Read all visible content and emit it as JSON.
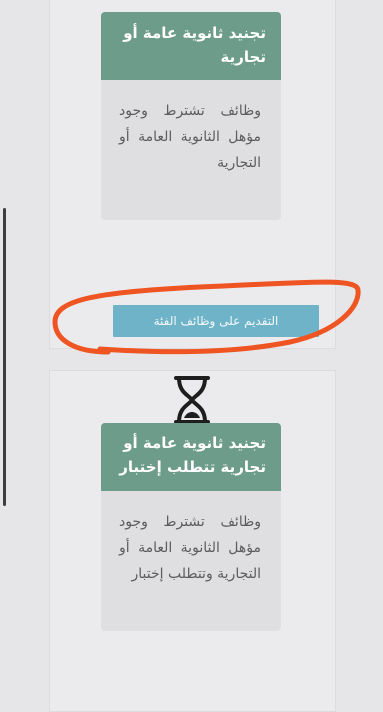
{
  "cards": [
    {
      "title": "تجنيد ثانوية عامة أو تجارية",
      "description": "وظائف تشترط وجود مؤهل الثانوية العامة أو التجارية"
    },
    {
      "title": "تجنيد ثانوية عامة أو تجارية تتطلب إختبار",
      "description": "وظائف تشترط وجود مؤهل الثانوية العامة أو التجارية وتتطلب إختبار"
    }
  ],
  "apply_button_label": "التقديم على وظائف الفئة",
  "colors": {
    "card_header": "#6d9c8a",
    "apply_button": "#6fb3c9",
    "annotation": "#ee5522"
  },
  "icons": {
    "loading": "hourglass-icon",
    "scrollbar": "scrollbar"
  }
}
